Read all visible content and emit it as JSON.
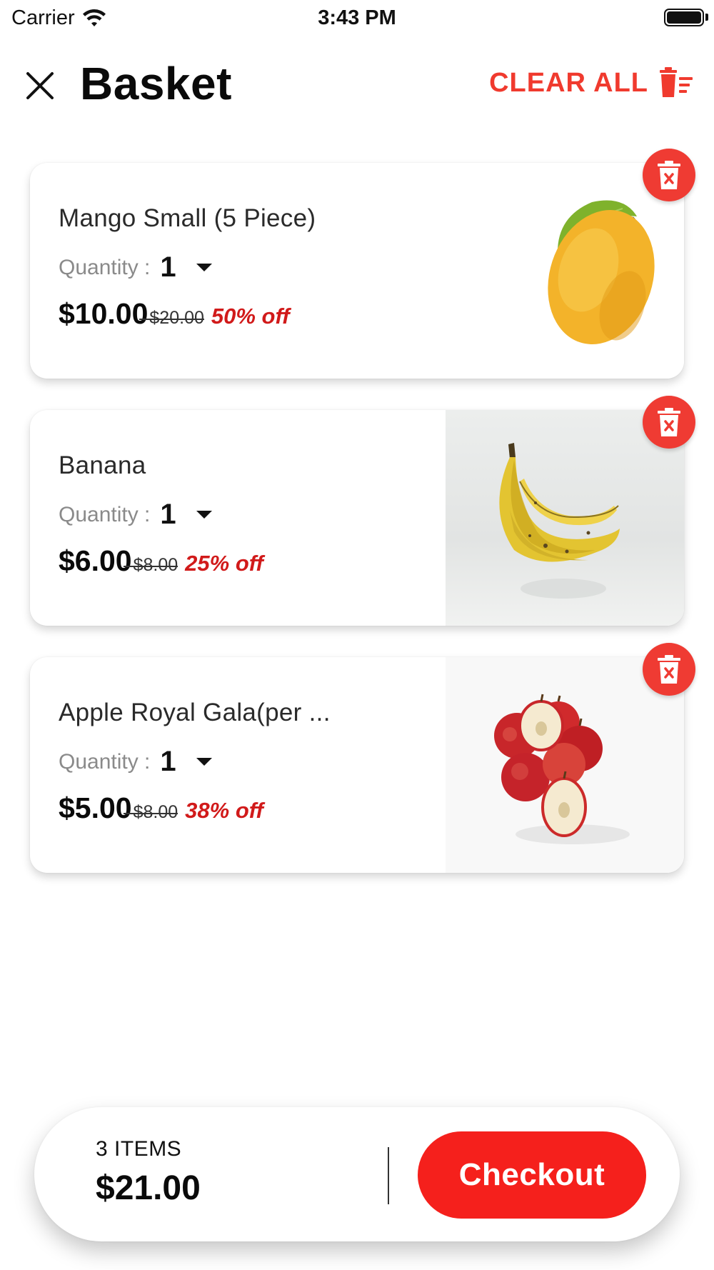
{
  "status_bar": {
    "carrier": "Carrier",
    "time": "3:43 PM",
    "icons": [
      "wifi-icon",
      "battery-icon"
    ]
  },
  "header": {
    "title": "Basket",
    "close_icon": "close-icon",
    "clear_all_label": "CLEAR ALL",
    "clear_all_icon": "trash-list-icon"
  },
  "colors": {
    "accent": "#f03a2e",
    "discount": "#d11a1a",
    "checkout": "#f5201c"
  },
  "items": [
    {
      "name": "Mango Small (5 Piece)",
      "quantity_label": "Quantity :",
      "quantity": "1",
      "price": "$10.00",
      "old_price": "$20.00",
      "discount": "50% off",
      "image": "mango-image",
      "remove_icon": "trash-x-icon"
    },
    {
      "name": "Banana",
      "quantity_label": "Quantity :",
      "quantity": "1",
      "price": "$6.00",
      "old_price": "$8.00",
      "discount": "25% off",
      "image": "banana-image",
      "remove_icon": "trash-x-icon"
    },
    {
      "name": "Apple Royal Gala(per ...",
      "quantity_label": "Quantity :",
      "quantity": "1",
      "price": "$5.00",
      "old_price": "$8.00",
      "discount": "38% off",
      "image": "apples-image",
      "remove_icon": "trash-x-icon"
    }
  ],
  "footer": {
    "items_count": "3 ITEMS",
    "total": "$21.00",
    "checkout_label": "Checkout"
  }
}
